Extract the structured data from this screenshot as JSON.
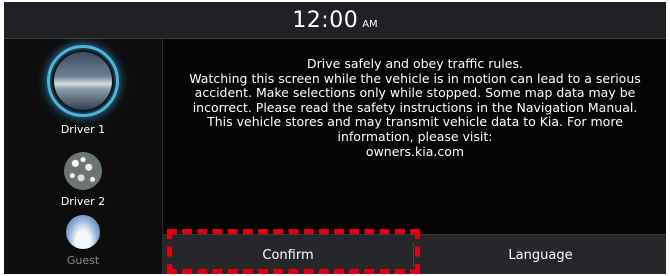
{
  "status_bar": {
    "time": "12:00",
    "ampm": "AM"
  },
  "profiles": [
    {
      "label": "Driver 1",
      "selected": true
    },
    {
      "label": "Driver 2",
      "selected": false
    },
    {
      "label": "Guest",
      "selected": false
    }
  ],
  "message": {
    "lines": [
      "Drive safely and obey traffic rules.",
      "Watching this screen while the vehicle is in motion can lead to a serious",
      "accident. Make selections only while stopped. Some map data may be",
      "incorrect. Please read the safety instructions in the Navigation Manual.",
      "This vehicle stores and may transmit vehicle data to Kia. For more",
      "information, please visit:",
      "owners.kia.com"
    ]
  },
  "buttons": {
    "confirm": "Confirm",
    "language": "Language"
  },
  "colors": {
    "background": "#000000",
    "active_ring": "#4fb5de",
    "highlight": "#e3000f",
    "bottom_bar": "#26272b"
  }
}
